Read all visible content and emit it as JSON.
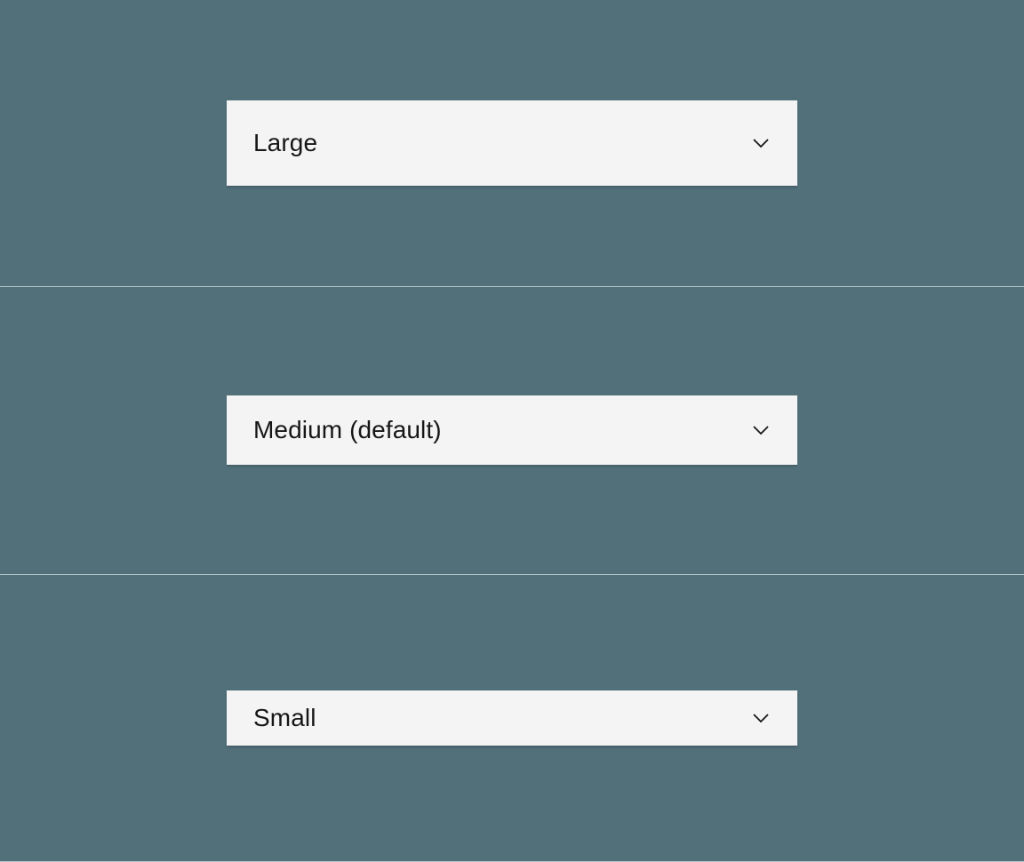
{
  "dropdowns": [
    {
      "label": "Large",
      "size": "large"
    },
    {
      "label": "Medium (default)",
      "size": "medium"
    },
    {
      "label": "Small",
      "size": "small"
    }
  ]
}
